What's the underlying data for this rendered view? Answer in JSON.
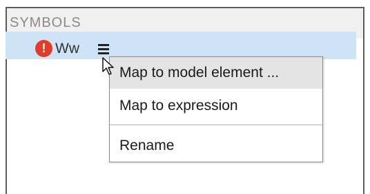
{
  "panel": {
    "title": "SYMBOLS"
  },
  "symbol": {
    "status_icon": "error-icon",
    "status_glyph": "!",
    "name": "Ww",
    "menu_icon": "hamburger-menu-icon"
  },
  "context_menu": {
    "items": [
      {
        "label": "Map to model element ...",
        "highlighted": true
      },
      {
        "label": "Map to expression",
        "highlighted": false
      },
      {
        "label": "Rename",
        "highlighted": false
      }
    ]
  },
  "colors": {
    "selected_row": "#cfe3f6",
    "error": "#e03c2c",
    "menu_hover": "#e4e4e4"
  }
}
